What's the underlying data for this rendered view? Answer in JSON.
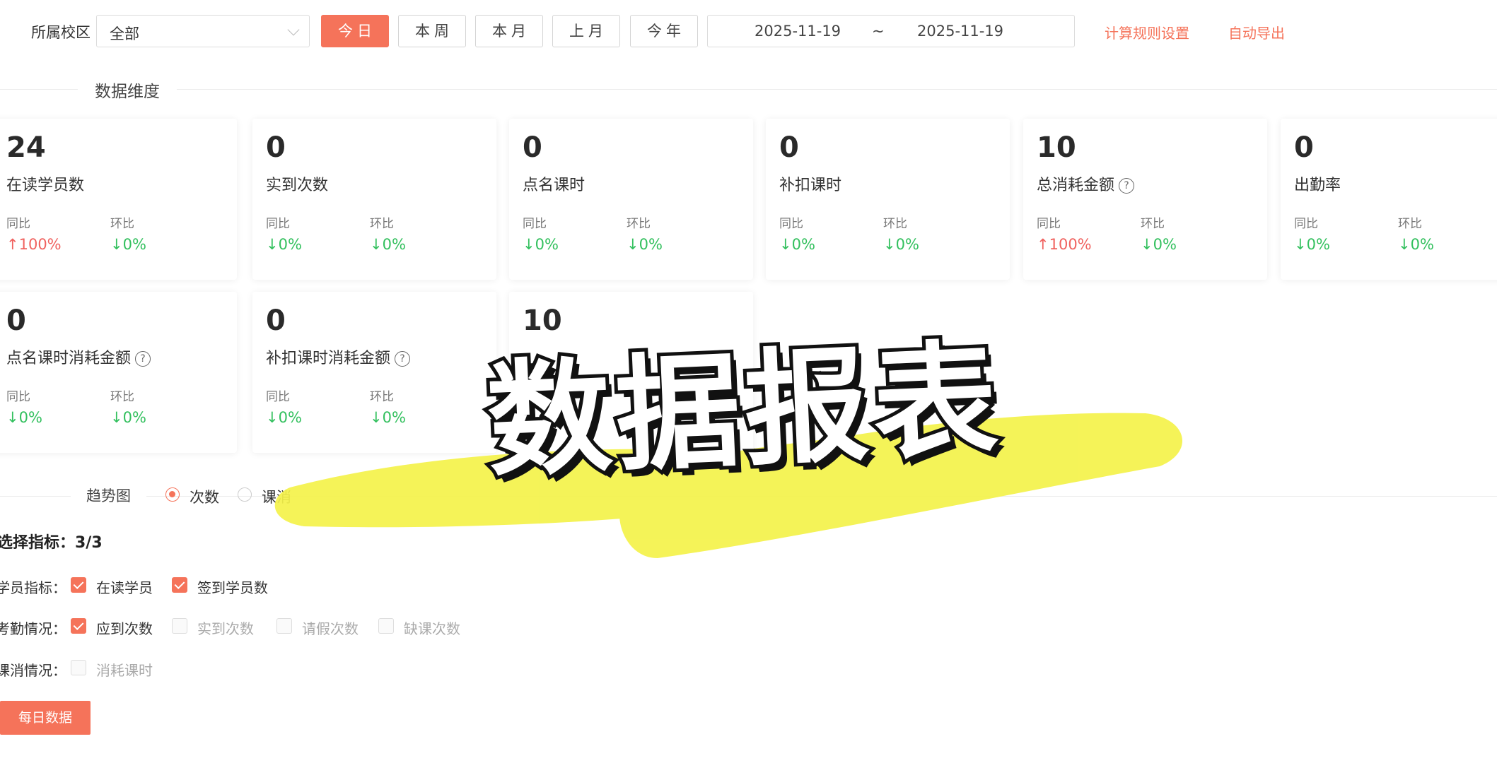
{
  "filter": {
    "campus_label": "所属校区",
    "campus_value": "全部",
    "ranges": [
      "今日",
      "本周",
      "本月",
      "上月",
      "今年"
    ],
    "active_range": "今日",
    "date_start": "2025-11-19",
    "date_sep": "~",
    "date_end": "2025-11-19",
    "rule_link": "计算规则设置",
    "export_link": "自动导出"
  },
  "section_title": "数据维度",
  "cards": [
    {
      "value": "24",
      "label": "在读学员数",
      "help": false,
      "yoy_label": "同比",
      "yoy": "↑100%",
      "yoy_dir": "up",
      "mom_label": "环比",
      "mom": "↓0%",
      "mom_dir": "down"
    },
    {
      "value": "0",
      "label": "实到次数",
      "help": false,
      "yoy_label": "同比",
      "yoy": "↓0%",
      "yoy_dir": "down",
      "mom_label": "环比",
      "mom": "↓0%",
      "mom_dir": "down"
    },
    {
      "value": "0",
      "label": "点名课时",
      "help": false,
      "yoy_label": "同比",
      "yoy": "↓0%",
      "yoy_dir": "down",
      "mom_label": "环比",
      "mom": "↓0%",
      "mom_dir": "down"
    },
    {
      "value": "0",
      "label": "补扣课时",
      "help": false,
      "yoy_label": "同比",
      "yoy": "↓0%",
      "yoy_dir": "down",
      "mom_label": "环比",
      "mom": "↓0%",
      "mom_dir": "down"
    },
    {
      "value": "10",
      "label": "总消耗金额",
      "help": true,
      "yoy_label": "同比",
      "yoy": "↑100%",
      "yoy_dir": "up",
      "mom_label": "环比",
      "mom": "↓0%",
      "mom_dir": "down"
    },
    {
      "value": "0",
      "label": "出勤率",
      "help": false,
      "yoy_label": "同比",
      "yoy": "↓0%",
      "yoy_dir": "down",
      "mom_label": "环比",
      "mom": "↓0%",
      "mom_dir": "down"
    },
    {
      "value": "0",
      "label": "点名课时消耗金额",
      "help": true,
      "yoy_label": "同比",
      "yoy": "↓0%",
      "yoy_dir": "down",
      "mom_label": "环比",
      "mom": "↓0%",
      "mom_dir": "down"
    },
    {
      "value": "0",
      "label": "补扣课时消耗金额",
      "help": true,
      "yoy_label": "同比",
      "yoy": "↓0%",
      "yoy_dir": "down",
      "mom_label": "环比",
      "mom": "↓0%",
      "mom_dir": "down"
    },
    {
      "value": "10",
      "label": "",
      "help": false,
      "yoy_label": "",
      "yoy": "",
      "yoy_dir": "up",
      "mom_label": "",
      "mom": "",
      "mom_dir": "down"
    }
  ],
  "trend": {
    "title": "趋势图",
    "options": [
      "次数",
      "课消"
    ],
    "selected": "次数",
    "pick_count": "选择指标：3/3",
    "rows": [
      {
        "label": "学员指标：",
        "items": [
          {
            "text": "在读学员",
            "checked": true
          },
          {
            "text": "签到学员数",
            "checked": true
          }
        ]
      },
      {
        "label": "考勤情况：",
        "items": [
          {
            "text": "应到次数",
            "checked": true
          },
          {
            "text": "实到次数",
            "checked": false
          },
          {
            "text": "请假次数",
            "checked": false
          },
          {
            "text": "缺课次数",
            "checked": false
          }
        ]
      },
      {
        "label": "课消情况：",
        "items": [
          {
            "text": "消耗课时",
            "checked": false
          }
        ]
      }
    ],
    "daily_button": "每日数据"
  },
  "overlay": {
    "title": "数据报表",
    "highlight_color": "#f4f24a"
  }
}
